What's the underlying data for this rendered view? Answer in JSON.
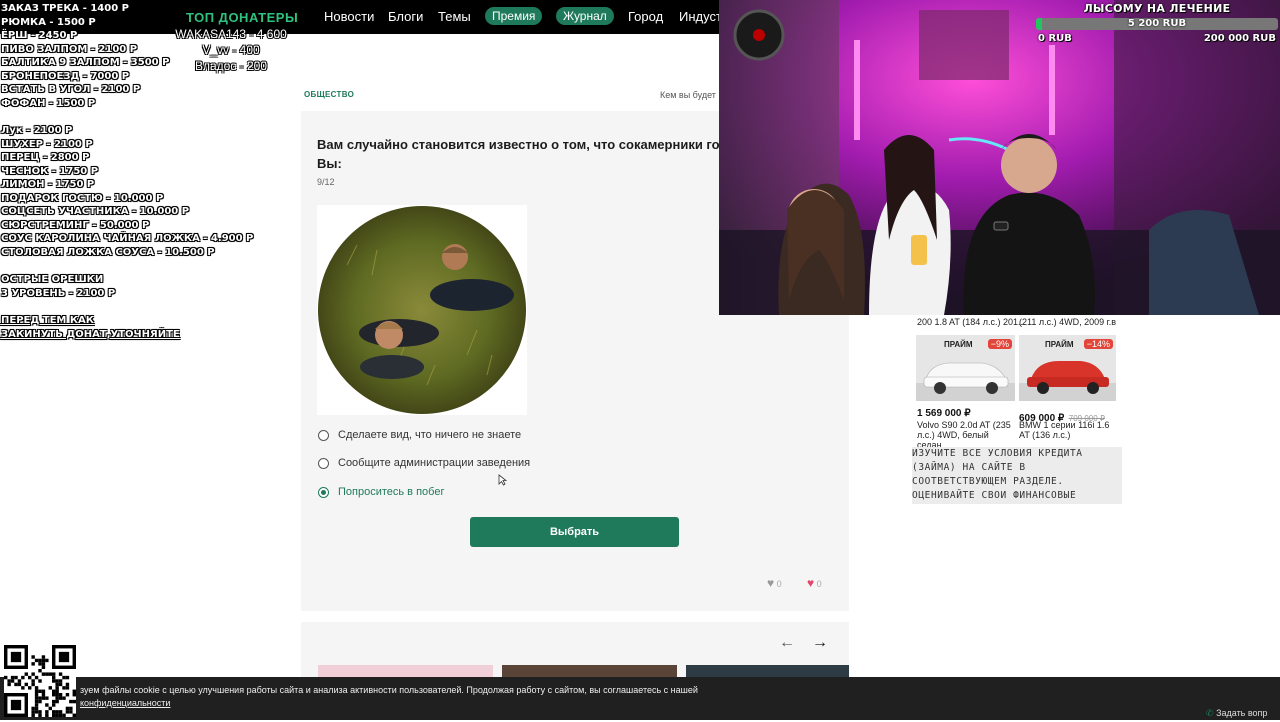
{
  "nav": {
    "logo": "ТОП ДОНАТЕРЫ",
    "items": [
      "Новости",
      "Блоги",
      "Темы"
    ],
    "premium": "Премия",
    "journal": "Журнал",
    "city": "Город",
    "industry": "Индустр"
  },
  "top_donors": {
    "lines": [
      "WAKASA143 - 4 600",
      "V_vv - 400",
      "Владос - 200"
    ]
  },
  "donation_menu": {
    "group1": [
      "ЗАКАЗ ТРЕКА - 1400 Р",
      "РЮМКА - 1500 Р",
      "ЁРШ - 2450 Р",
      "ПИВО ЗАЛПОМ - 2100 Р",
      "БАЛТИКА 9 ЗАЛПОМ - 3500 Р",
      "БРОНЕПОЕЗД - 7000 Р",
      "ВСТАТЬ В УГОЛ - 2100 Р",
      "ФОФАН - 1500 Р"
    ],
    "group2": [
      "Лук - 2100 Р",
      "ШУХЕР - 2100 Р",
      "ПЕРЕЦ - 2800 Р",
      "ЧЕСНОК - 1750 Р",
      "ЛИМОН - 1750 Р",
      "ПОДАРОК ГОСТЮ - 10.000 Р",
      "СОЦСЕТЬ УЧАСТНИКА - 10.000 Р",
      "СЮРСТРЕМИНГ - 50.000 Р",
      "СОУС КАРОЛИНА ЧАЙНАЯ ЛОЖКА - 4.900 Р",
      "СТОЛОВАЯ ЛОЖКА СОУСА - 10.500 Р"
    ],
    "group3": [
      "ОСТРЫЕ ОРЕШКИ",
      "3 УРОВЕНЬ - 2100 Р"
    ],
    "group4": [
      "ПЕРЕД ТЕМ КАК",
      "ЗАКИНУТЬ ДОНАТ,УТОЧНЯЙТЕ"
    ]
  },
  "article": {
    "category": "ОБЩЕСТВО",
    "byline": "Кем вы будет"
  },
  "quiz": {
    "question_line1": "Вам случайно становится известно о том, что сокамерники гот",
    "question_line2": "Вы:",
    "progress": "9/12",
    "options": [
      "Сделаете вид, что ничего не знаете",
      "Сообщите администрации заведения",
      "Попроситесь в побег"
    ],
    "selected_index": 2,
    "submit": "Выбрать",
    "likes": "0",
    "hearts": "0"
  },
  "goal": {
    "title": "ЛЫСОМУ НА ЛЕЧЕНИЕ",
    "current": "5 200 RUB",
    "min": "0 RUB",
    "max": "200 000 RUB",
    "progress_fraction": 0.026
  },
  "ads": {
    "top_left_caption": "200 1.8 AT (184 л.с.) 201...",
    "top_right_caption": "(211 л.с.) 4WD, 2009 г.в",
    "brand": "ПРАЙМ",
    "cars": [
      {
        "discount": "−9%",
        "price": "1 569 000 ₽",
        "old_price": "",
        "desc": "Volvo S90 2.0d AT (235 л.с.) 4WD, белый седан,..."
      },
      {
        "discount": "−14%",
        "price": "609 000 ₽",
        "old_price": "709 000 ₽",
        "desc": "BMW 1 серии 116i 1.6 AT (136 л.с.)"
      }
    ],
    "disclaimer": "ИЗУЧИТЕ ВСЕ УСЛОВИЯ КРЕДИТА (ЗАЙМА) НА САЙТЕ В СООТВЕТСТВУЮЩЕМ РАЗДЕЛЕ. ОЦЕНИВАЙТЕ СВОИ ФИНАНСОВЫЕ ВОЗМОЖНОСТИ И РИСКИ"
  },
  "cookie": {
    "line1": "зуем файлы cookie с целью улучшения работы сайта и анализа активности пользователей. Продолжая работу с сайтом, вы соглашаетесь с нашей",
    "line2": "конфиденциальности",
    "right": "Задать вопр"
  },
  "colors": {
    "accent": "#1f7a5c",
    "topbar": "#000000",
    "card": "#f4f5f4",
    "goal_bar": "#22c55e"
  }
}
